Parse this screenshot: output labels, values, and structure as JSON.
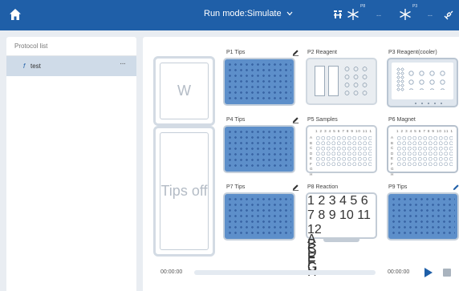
{
  "topbar": {
    "home_icon": "home-icon",
    "run_mode_label": "Run mode:Simulate",
    "run_mode_chevron": "chevron-down-icon",
    "module_1_sup": "P8",
    "module_2_sup": "P3",
    "module_1_dash": "--",
    "module_2_dash": "--",
    "colors": {
      "bar": "#1f5fa8",
      "accent": "#1f5fa8"
    }
  },
  "sidebar": {
    "header": "Protocol list",
    "items": [
      {
        "icon": "f",
        "label": "test",
        "more": "···",
        "selected": true
      }
    ]
  },
  "deck": {
    "waste_label": "W",
    "tips_off_label": "Tips off",
    "slots": [
      {
        "label": "P1 Tips",
        "type": "tips",
        "editable": true
      },
      {
        "label": "P2 Reagent",
        "type": "reagent",
        "editable": false
      },
      {
        "label": "P3 Reagent(cooler)",
        "type": "cooler",
        "editable": false
      },
      {
        "label": "P4 Tips",
        "type": "tips",
        "editable": true
      },
      {
        "label": "P5 Samples",
        "type": "well-plate",
        "editable": false
      },
      {
        "label": "P6 Magnet",
        "type": "well-plate",
        "editable": false
      },
      {
        "label": "P7 Tips",
        "type": "tips",
        "editable": true
      },
      {
        "label": "P8 Reaction",
        "type": "well-plate",
        "editable": false
      },
      {
        "label": "P9 Tips",
        "type": "tips",
        "editable": true
      }
    ],
    "plate_columns": "1 2 3 4 5 6 7 8 9 10 11 12",
    "plate_rows": [
      "A",
      "B",
      "C",
      "D",
      "E",
      "F",
      "G",
      "H"
    ]
  },
  "playback": {
    "elapsed": "00:00:00",
    "remaining": "00:00:00",
    "progress": 0
  }
}
